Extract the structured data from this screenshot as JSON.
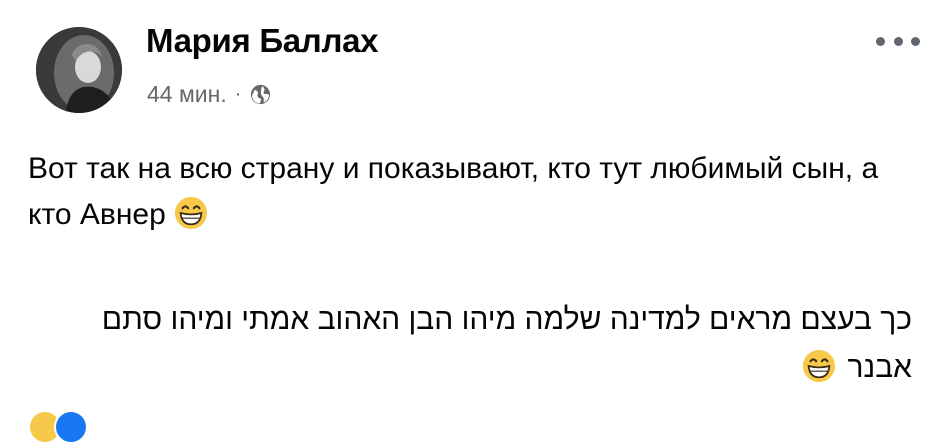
{
  "post": {
    "author_name": "Мария Баллах",
    "timestamp": "44 мин.",
    "separator": "·",
    "audience_icon": "globe-icon",
    "more_icon": "more-options-icon",
    "text_ru": "Вот так на всю страну и показывают, кто тут любимый сын, а кто Авнер",
    "text_he": "כך בעצם מראים למדינה שלמה מיהו הבן האהוב אמתי ומיהו סתם אבנר",
    "emoji": "grinning-face-with-smiling-eyes"
  },
  "colors": {
    "text": "#050505",
    "secondary": "#65676b",
    "emoji_yellow": "#f7c94b",
    "like_blue": "#1877f2"
  }
}
